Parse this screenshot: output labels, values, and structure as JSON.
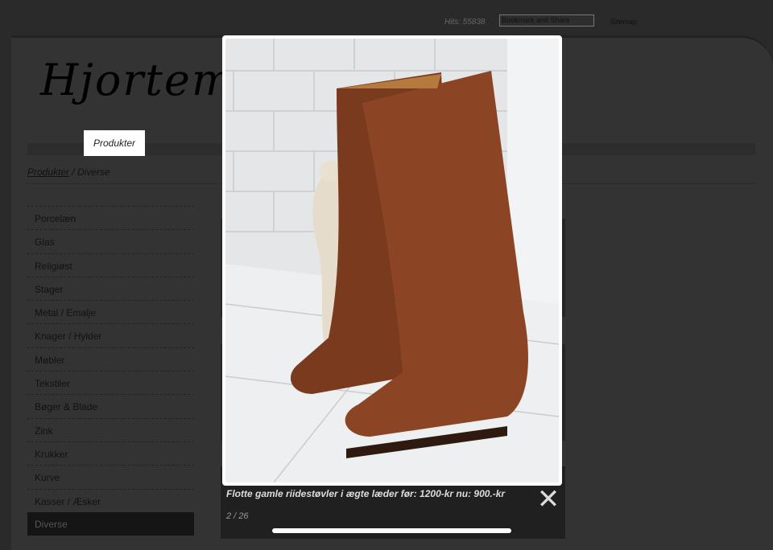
{
  "header": {
    "hits": "Hits: 55838",
    "bookmark": "Bookmark and Share",
    "sitemap": "Sitemap",
    "logo": "Hjortemo            tik"
  },
  "nav": {
    "active": "Produkter"
  },
  "breadcrumb": {
    "link": "Produkter",
    "current": " / Diverse"
  },
  "sidebar": {
    "items": [
      "Porcelæn",
      "Glas",
      "Religiøst",
      "Stager",
      "Metal / Emalje",
      "Knager / Hylder",
      "Møbler",
      "Tekstiler",
      "Bøger & Blade",
      "Zink",
      "Krukker",
      "Kurve",
      "Kasser / Æsker",
      "Diverse"
    ]
  },
  "lightbox": {
    "caption": "Flotte gamle riidestøvler i ægte læder før: 1200-kr nu: 900.-kr",
    "counter": "2 / 26",
    "close": "✕"
  }
}
